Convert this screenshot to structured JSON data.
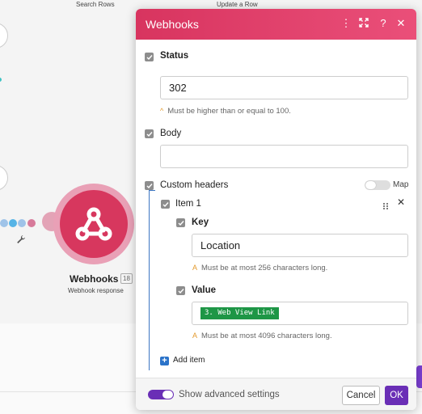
{
  "canvas": {
    "top_labels": [
      "Search Rows",
      "Update a Row"
    ],
    "node": {
      "name": "Webhooks",
      "badge": "18",
      "subtitle": "Webhook response",
      "color": "#d7375e"
    },
    "dot_colors": [
      "#9fc3e8",
      "#56b4e6",
      "#9fc3e8",
      "#d77a9a"
    ]
  },
  "modal": {
    "title": "Webhooks",
    "header_icons": [
      "kebab-icon",
      "expand-icon",
      "help-icon",
      "close-icon"
    ],
    "header_color": "#d8345f",
    "status": {
      "label": "Status",
      "value": "302",
      "hint": "Must be higher than or equal to 100."
    },
    "body_field": {
      "label": "Body",
      "value": ""
    },
    "custom_headers": {
      "label": "Custom headers",
      "map_label": "Map",
      "map_enabled": false,
      "items": [
        {
          "label": "Item 1",
          "key_label": "Key",
          "key_value": "Location",
          "key_hint": "Must be at most 256 characters long.",
          "value_label": "Value",
          "value_token": "3. Web View Link",
          "value_hint": "Must be at most 4096 characters long."
        }
      ],
      "add_item_label": "Add item"
    },
    "footer": {
      "advanced_label": "Show advanced settings",
      "advanced_enabled": true,
      "cancel_label": "Cancel",
      "ok_label": "OK",
      "accent_color": "#6a2fb6"
    }
  }
}
